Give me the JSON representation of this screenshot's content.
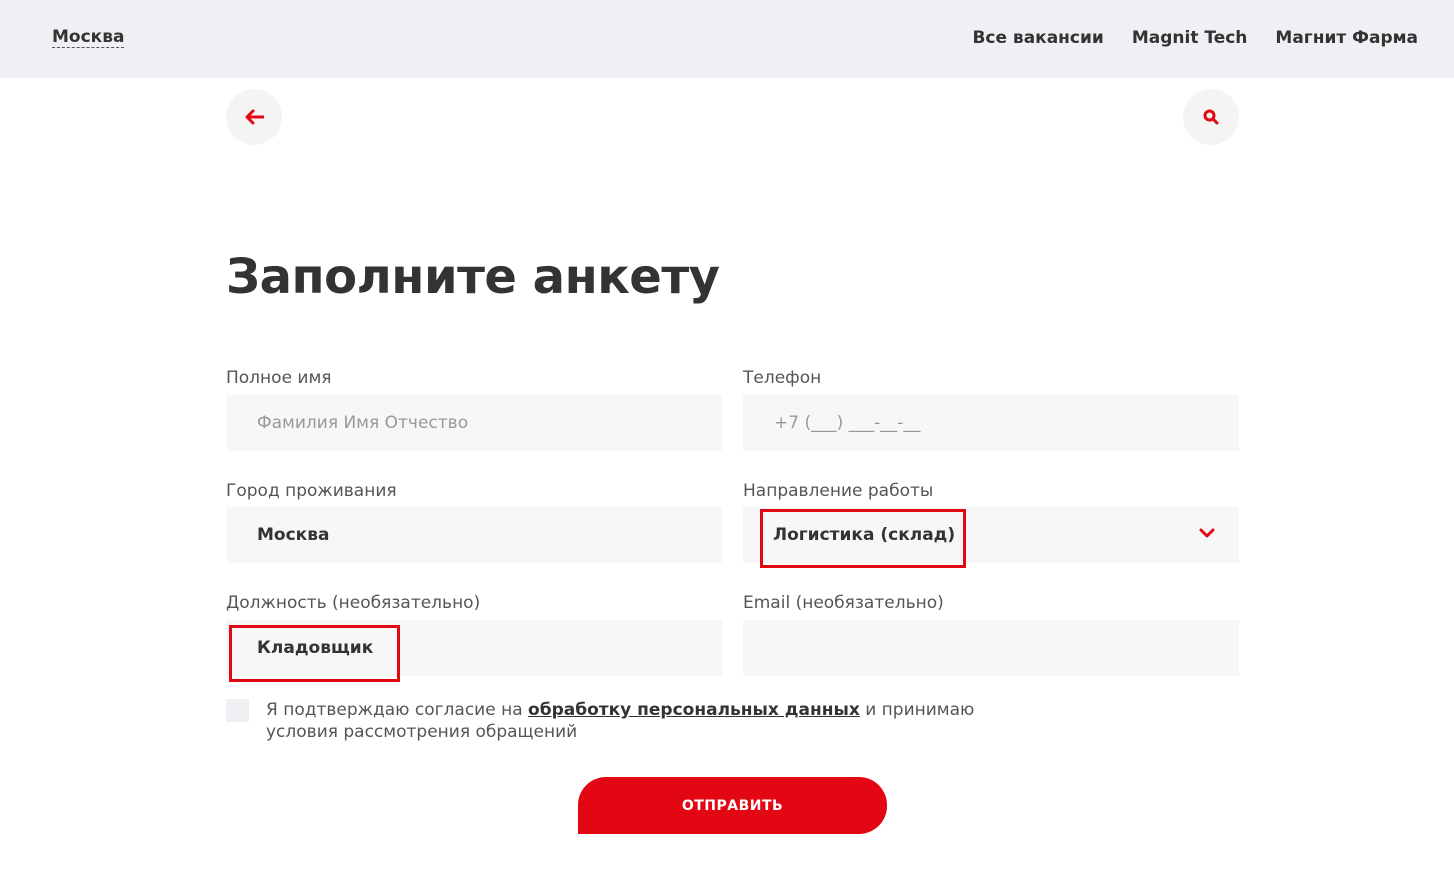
{
  "header": {
    "city": "Москва",
    "nav": [
      "Все вакансии",
      "Magnit Tech",
      "Магнит Фарма"
    ]
  },
  "title": "Заполните анкету",
  "form": {
    "full_name": {
      "label": "Полное имя",
      "placeholder": "Фамилия Имя Отчество",
      "value": ""
    },
    "phone": {
      "label": "Телефон",
      "placeholder": "+7 (___) ___-__-__",
      "value": ""
    },
    "city": {
      "label": "Город проживания",
      "value": "Москва"
    },
    "direction": {
      "label": "Направление работы",
      "value": "Логистика (склад)"
    },
    "position": {
      "label": "Должность (необязательно)",
      "value": "Кладовщик"
    },
    "email": {
      "label": "Email (необязательно)",
      "value": ""
    }
  },
  "consent": {
    "checked": false,
    "text_before": "Я подтверждаю согласие на ",
    "link": "обработку персональных данных",
    "text_after": " и принимаю условия рассмотрения обращений"
  },
  "submit_label": "ОТПРАВИТЬ",
  "colors": {
    "accent": "#e30613",
    "topbar": "#eef0f3",
    "field_bg": "#f7f7f7"
  },
  "icons": {
    "back": "arrow-left-icon",
    "search": "search-icon",
    "dropdown": "chevron-down-icon"
  }
}
